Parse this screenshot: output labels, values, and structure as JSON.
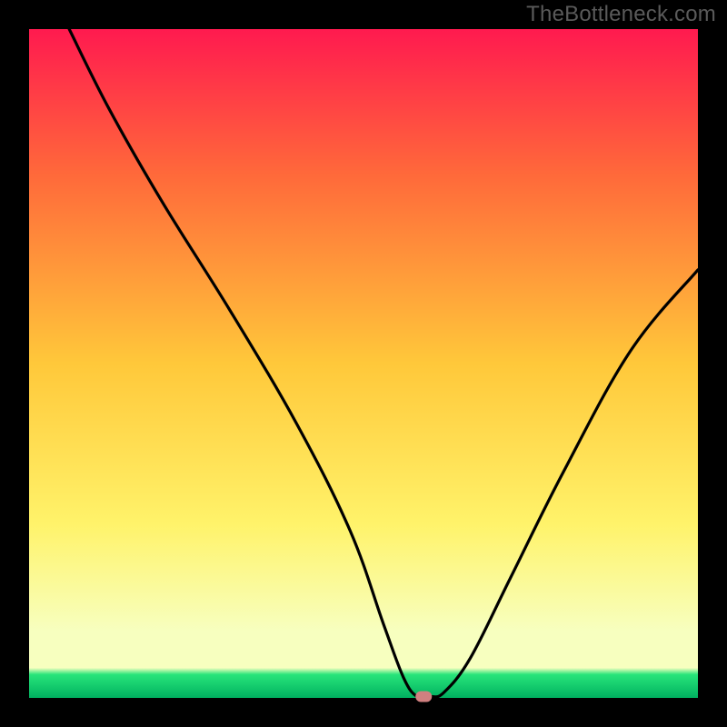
{
  "watermark": "TheBottleneck.com",
  "colors": {
    "frame": "#000000",
    "line": "#000000",
    "marker": "#d08080",
    "gradient": {
      "top": "#ff1a4f",
      "upper": "#ff6a3a",
      "mid": "#ffc83a",
      "lower": "#fff36a",
      "pale": "#f7ffbf",
      "grass": "#28e57a",
      "deep": "#00b060"
    }
  },
  "chart_data": {
    "type": "line",
    "title": "",
    "xlabel": "",
    "ylabel": "",
    "xlim": [
      0,
      100
    ],
    "ylim": [
      0,
      100
    ],
    "series": [
      {
        "name": "bottleneck-curve",
        "x": [
          6,
          12,
          20,
          30,
          40,
          48,
          53,
          56,
          58,
          60,
          62,
          66,
          72,
          80,
          90,
          100
        ],
        "values": [
          100,
          88,
          74,
          58,
          41,
          25,
          11,
          3,
          0.2,
          0.2,
          0.8,
          6,
          18,
          34,
          52,
          64
        ]
      }
    ],
    "marker": {
      "x": 59,
      "y": 0.2
    }
  }
}
